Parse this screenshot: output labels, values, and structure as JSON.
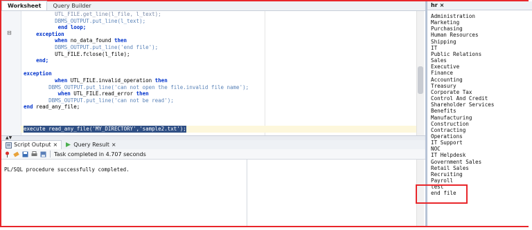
{
  "worksheet": {
    "tabs": [
      "Worksheet",
      "Query Builder"
    ],
    "code_lines": [
      {
        "indent": "          ",
        "parts": [
          {
            "t": "UTL_FILE.get_line(l_file, l_text);",
            "c": "fn"
          }
        ]
      },
      {
        "indent": "          ",
        "parts": [
          {
            "t": "DBMS_OUTPUT.put_line(l_text);",
            "c": "str"
          }
        ]
      },
      {
        "indent": "           ",
        "parts": [
          {
            "t": "end loop;",
            "c": "kw"
          }
        ]
      },
      {
        "indent": "    ",
        "parts": [
          {
            "t": "exception",
            "c": "kw"
          }
        ]
      },
      {
        "indent": "          ",
        "parts": [
          {
            "t": "when",
            "c": "kw"
          },
          {
            "t": " no_data_found ",
            "c": ""
          },
          {
            "t": "then",
            "c": "kw"
          }
        ]
      },
      {
        "indent": "          ",
        "parts": [
          {
            "t": "DBMS_OUTPUT.put_line('end file');",
            "c": "str"
          }
        ]
      },
      {
        "indent": "          ",
        "parts": [
          {
            "t": "UTL_FILE.fclose(l_file);",
            "c": ""
          }
        ]
      },
      {
        "indent": "    ",
        "parts": [
          {
            "t": "end;",
            "c": "kw"
          }
        ]
      },
      {
        "indent": "",
        "parts": [
          {
            "t": "",
            "c": ""
          }
        ]
      },
      {
        "indent": "",
        "parts": [
          {
            "t": "exception",
            "c": "kw"
          }
        ]
      },
      {
        "indent": "          ",
        "parts": [
          {
            "t": "when",
            "c": "kw"
          },
          {
            "t": " UTL_FILE.invalid_operation ",
            "c": ""
          },
          {
            "t": "then",
            "c": "kw"
          }
        ]
      },
      {
        "indent": "        ",
        "parts": [
          {
            "t": "DBMS_OUTPUT.put_line('can not open the file.invalid file name');",
            "c": "str"
          }
        ]
      },
      {
        "indent": "           ",
        "parts": [
          {
            "t": "when",
            "c": "kw"
          },
          {
            "t": " UTL_FILE.read_error ",
            "c": ""
          },
          {
            "t": "then",
            "c": "kw"
          }
        ]
      },
      {
        "indent": "        ",
        "parts": [
          {
            "t": "DBMS_OUTPUT.put_line('can not be read');",
            "c": "str"
          }
        ]
      },
      {
        "indent": "",
        "parts": [
          {
            "t": "end",
            "c": "kw"
          },
          {
            "t": " read_any_file;",
            "c": ""
          }
        ]
      }
    ],
    "execute_line": "execute read_any_file('MY_DIRECTORY','sample2.txt');"
  },
  "output_panel": {
    "tabs": [
      {
        "label": "Script Output",
        "close": "×",
        "icon": "script-output-icon"
      },
      {
        "label": "Query Result",
        "close": "×",
        "icon": "query-result-icon"
      }
    ],
    "status": "Task completed in 4.707 seconds",
    "message": "PL/SQL procedure successfully completed."
  },
  "results_panel": {
    "tab_label": "hr",
    "tab_close": "×",
    "items": [
      "Administration",
      "Marketing",
      "Purchasing",
      "Human Resources",
      "Shipping",
      "IT",
      "Public Relations",
      "Sales",
      "Executive",
      "Finance",
      "Accounting",
      "Treasury",
      "Corporate Tax",
      "Control And Credit",
      "Shareholder Services",
      "Benefits",
      "Manufacturing",
      "Construction",
      "Contracting",
      "Operations",
      "IT Support",
      "NOC",
      "IT Helpdesk",
      "Government Sales",
      "Retail Sales",
      "Recruiting",
      "Payroll",
      "test",
      "end file"
    ]
  },
  "colors": {
    "highlight_border": "#e8262a",
    "keyword": "#0033cc",
    "string": "#5a83b8",
    "selection": "#2f4f84"
  }
}
